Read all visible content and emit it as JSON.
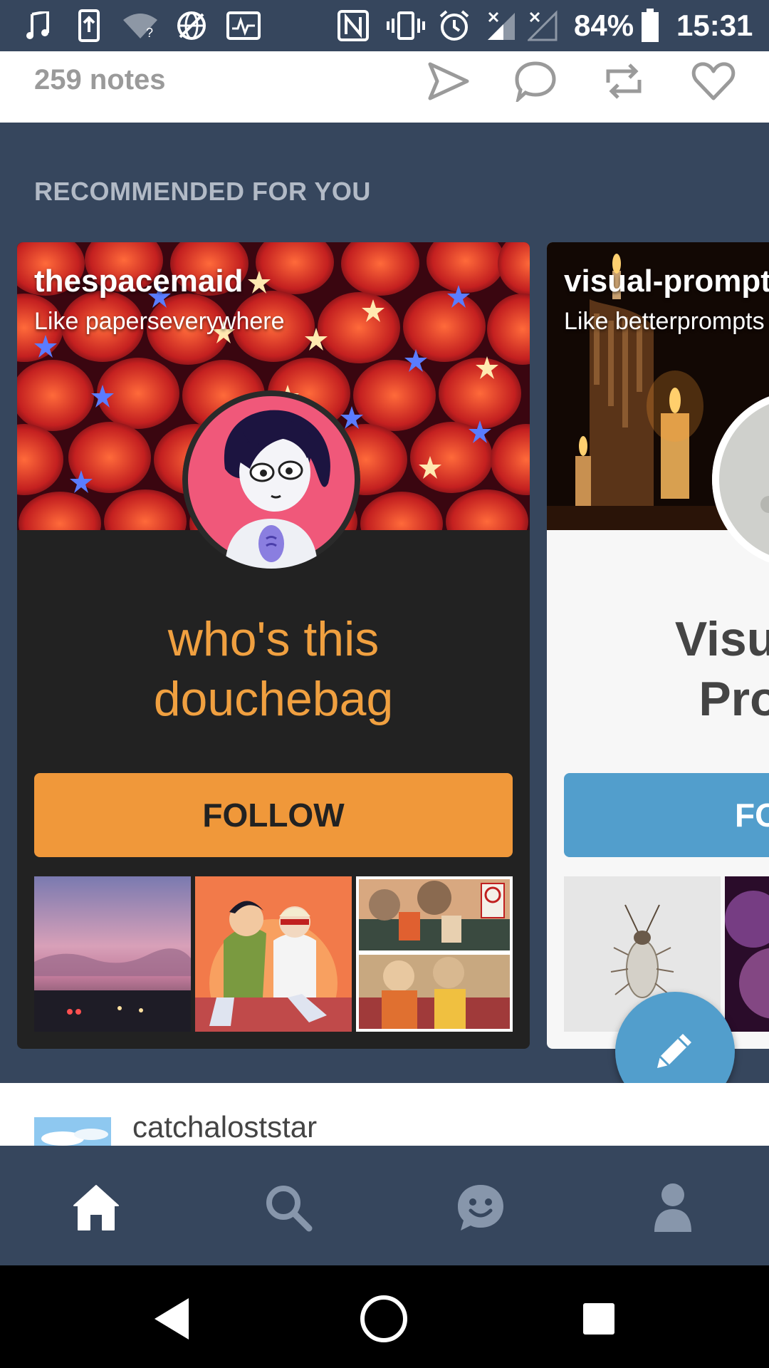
{
  "status_bar": {
    "battery": "84%",
    "time": "15:31",
    "icons": [
      "music-icon",
      "upload-icon",
      "wifi-icon",
      "globe-icon",
      "pulse-icon",
      "nfc-icon",
      "vibrate-icon",
      "alarm-icon",
      "signal-icon",
      "signal-icon",
      "battery-icon"
    ]
  },
  "post_footer": {
    "notes": "259 notes",
    "actions": [
      "send-icon",
      "comment-icon",
      "reblog-icon",
      "heart-icon"
    ]
  },
  "recommended": {
    "heading": "RECOMMENDED FOR YOU",
    "cards": [
      {
        "blog_name": "thespacemaid",
        "like_text": "Like paperseverywhere",
        "title_line1": "who's this",
        "title_line2": "douchebag",
        "follow_label": "FOLLOW",
        "title_color": "#f0a040",
        "button_color": "#f0983a"
      },
      {
        "blog_name": "visual-prompt",
        "like_text": "Like betterprompts",
        "title_line1": "Visua",
        "title_line2": "Pro",
        "follow_label": "FO",
        "title_color": "#444444",
        "button_color": "#529ecc"
      }
    ]
  },
  "next_post": {
    "blog_name": "catchaloststar"
  },
  "bottom_nav": {
    "items": [
      "home-icon",
      "search-icon",
      "activity-icon",
      "account-icon"
    ]
  },
  "system_nav": {
    "items": [
      "back-icon",
      "home-circle-icon",
      "recents-icon"
    ]
  },
  "colors": {
    "background": "#36465d",
    "fab": "#529ecc"
  }
}
